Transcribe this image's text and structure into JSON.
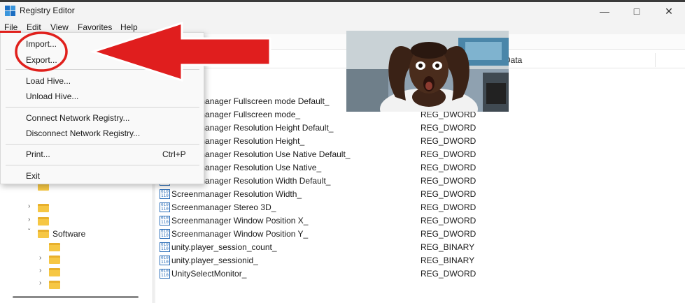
{
  "window": {
    "title": "Registry Editor"
  },
  "menubar": [
    "File",
    "Edit",
    "View",
    "Favorites",
    "Help"
  ],
  "file_menu": {
    "groups": [
      [
        {
          "label": "Import..."
        },
        {
          "label": "Export..."
        }
      ],
      [
        {
          "label": "Load Hive..."
        },
        {
          "label": "Unload Hive..."
        }
      ],
      [
        {
          "label": "Connect Network Registry..."
        },
        {
          "label": "Disconnect Network Registry..."
        }
      ],
      [
        {
          "label": "Print...",
          "shortcut": "Ctrl+P"
        }
      ],
      [
        {
          "label": "Exit"
        }
      ]
    ]
  },
  "list": {
    "header_data": "Data",
    "rows": [
      {
        "name": "Screenmanager Fullscreen mode Default_",
        "type": ""
      },
      {
        "name": "Screenmanager Fullscreen mode_",
        "type": "REG_DWORD"
      },
      {
        "name": "Screenmanager Resolution Height Default_",
        "type": "REG_DWORD"
      },
      {
        "name": "Screenmanager Resolution Height_",
        "type": "REG_DWORD"
      },
      {
        "name": "Screenmanager Resolution Use Native Default_",
        "type": "REG_DWORD"
      },
      {
        "name": "Screenmanager Resolution Use Native_",
        "type": "REG_DWORD"
      },
      {
        "name": "Screenmanager Resolution Width Default_",
        "type": "REG_DWORD"
      },
      {
        "name": "Screenmanager Resolution Width_",
        "type": "REG_DWORD"
      },
      {
        "name": "Screenmanager Stereo 3D_",
        "type": "REG_DWORD"
      },
      {
        "name": "Screenmanager Window Position X_",
        "type": "REG_DWORD"
      },
      {
        "name": "Screenmanager Window Position Y_",
        "type": "REG_DWORD"
      },
      {
        "name": "unity.player_session_count_",
        "type": "REG_BINARY"
      },
      {
        "name": "unity.player_sessionid_",
        "type": "REG_BINARY"
      },
      {
        "name": "UnitySelectMonitor_",
        "type": "REG_DWORD"
      }
    ]
  },
  "tree": {
    "software_label": "Software"
  },
  "colors": {
    "accent": "#e0201c",
    "folder": "#f6c744",
    "value_icon": "#2d6fb8"
  }
}
